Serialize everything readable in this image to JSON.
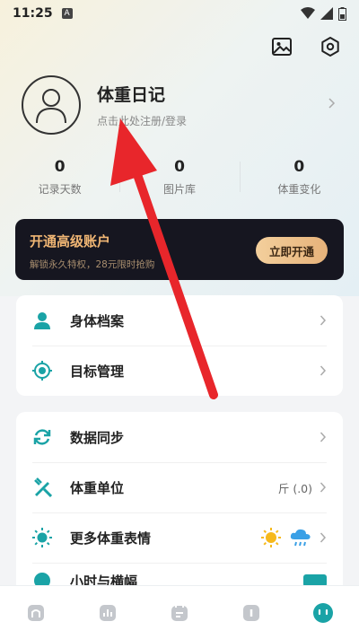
{
  "status": {
    "time": "11:25",
    "notif": "A"
  },
  "profile": {
    "app_title": "体重日记",
    "login_hint": "点击此处注册/登录"
  },
  "stats": [
    {
      "value": "0",
      "label": "记录天数"
    },
    {
      "value": "0",
      "label": "图片库"
    },
    {
      "value": "0",
      "label": "体重变化"
    }
  ],
  "premium": {
    "title": "开通高级账户",
    "subtitle": "解锁永久特权，28元限时抢购",
    "button": "立即开通"
  },
  "menu1": [
    {
      "label": "身体档案",
      "icon": "person-icon"
    },
    {
      "label": "目标管理",
      "icon": "target-icon"
    }
  ],
  "menu2": [
    {
      "label": "数据同步",
      "icon": "sync-icon"
    },
    {
      "label": "体重单位",
      "icon": "ruler-pencil-icon",
      "value": "斤 (.0)"
    },
    {
      "label": "更多体重表情",
      "icon": "sun-icon"
    },
    {
      "label": "小时与横幅",
      "icon": "clock-icon"
    }
  ],
  "colors": {
    "accent": "#1aa3a6",
    "premium_gold": "#f0b674",
    "arrow": "#e8262b"
  }
}
